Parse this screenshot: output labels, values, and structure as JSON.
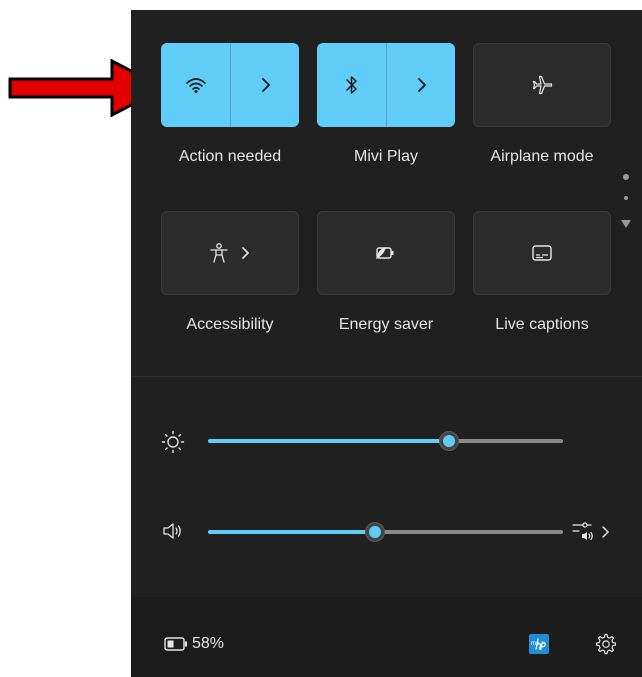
{
  "tiles": [
    {
      "label": "Action needed",
      "state": "on",
      "icon": "wifi-icon",
      "has_expand": true
    },
    {
      "label": "Mivi Play",
      "state": "on",
      "icon": "bluetooth-icon",
      "has_expand": true
    },
    {
      "label": "Airplane mode",
      "state": "off",
      "icon": "airplane-icon",
      "has_expand": false
    },
    {
      "label": "Accessibility",
      "state": "off",
      "icon": "accessibility-icon",
      "has_expand": true
    },
    {
      "label": "Energy saver",
      "state": "off",
      "icon": "energy-saver-icon",
      "has_expand": false
    },
    {
      "label": "Live captions",
      "state": "off",
      "icon": "live-captions-icon",
      "has_expand": false
    }
  ],
  "brightness": {
    "icon": "brightness-icon",
    "level": 0.68
  },
  "volume": {
    "icon": "speaker-icon",
    "level": 0.47,
    "output_icon": "audio-output-icon"
  },
  "battery": {
    "icon": "battery-icon",
    "percent": "58%"
  },
  "settings_icon": "gear-icon",
  "app_icon": "myhp-app-icon",
  "app_label": "my",
  "annotation": {
    "icon": "red-arrow-icon",
    "color": "#e00000"
  },
  "colors": {
    "accent": "#60ccf8",
    "panel": "#202020",
    "tile_off": "#2c2c2c"
  }
}
